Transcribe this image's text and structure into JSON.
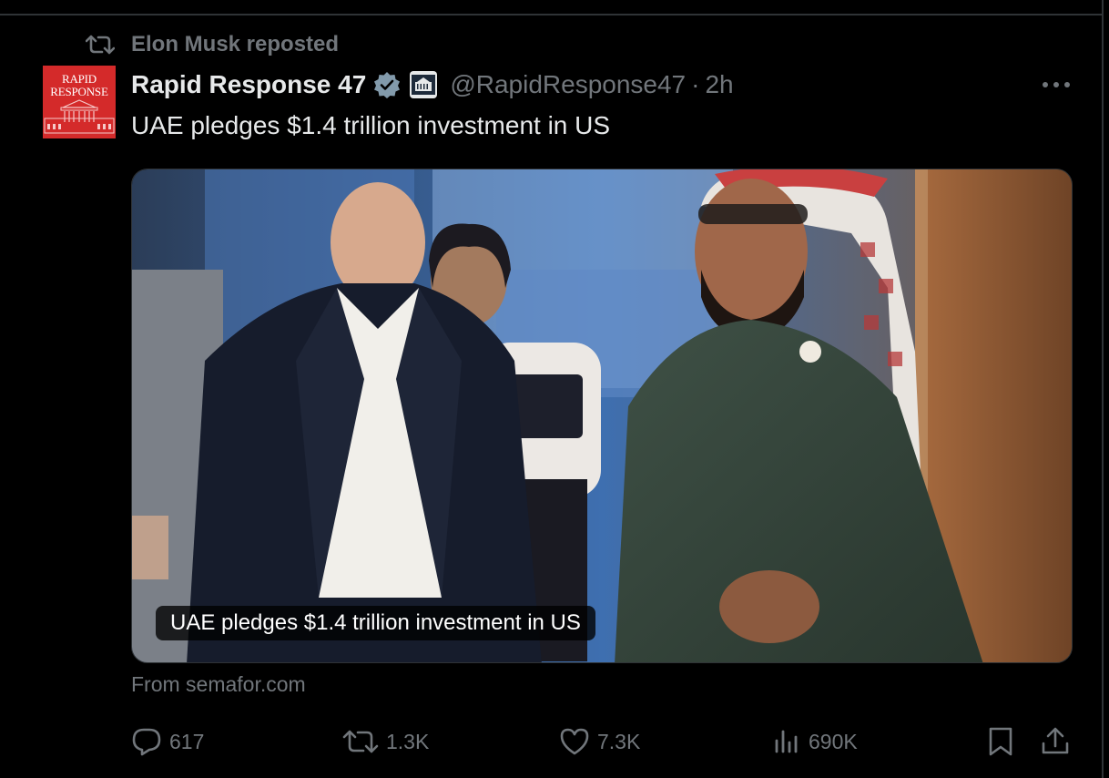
{
  "repost": {
    "label": "Elon Musk reposted",
    "icon": "repost-icon"
  },
  "author": {
    "avatar_text_line1": "RAPID",
    "avatar_text_line2": "RESPONSE",
    "display_name": "Rapid Response 47",
    "handle": "@RapidResponse47",
    "separator": "·",
    "time": "2h",
    "verified_icon": "verified-badge-icon",
    "affiliate_icon": "white-house-icon"
  },
  "tweet": {
    "text": "UAE pledges $1.4 trillion investment in US"
  },
  "card": {
    "caption": "UAE pledges $1.4 trillion investment in US",
    "source": "From semafor.com"
  },
  "actions": {
    "replies": "617",
    "reposts": "1.3K",
    "likes": "7.3K",
    "views": "690K"
  },
  "colors": {
    "background": "#000000",
    "primary_text": "#e7e9ea",
    "secondary_text": "#71767b",
    "verified_badge": "#829aab",
    "avatar_red": "#d42a2a"
  }
}
